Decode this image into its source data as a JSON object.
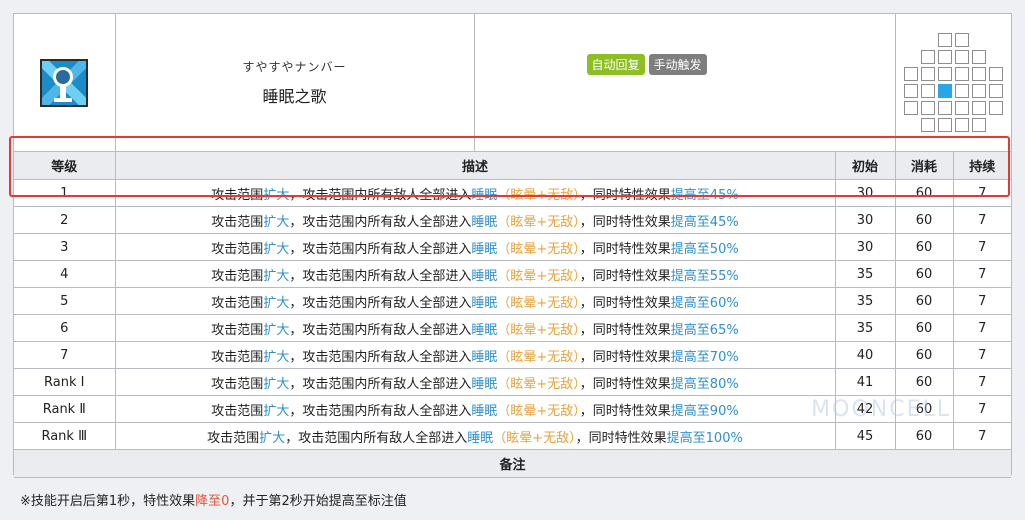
{
  "skill": {
    "subname": "すやすやナンバー",
    "name": "睡眠之歌",
    "icon": "microphone-icon",
    "tags": [
      {
        "label": "自动回复",
        "color": "#8dbf22"
      },
      {
        "label": "手动触发",
        "color": "#7e7e7e"
      }
    ]
  },
  "range_grid": {
    "cells": [
      [
        0,
        2
      ],
      [
        0,
        3
      ],
      [
        1,
        1
      ],
      [
        1,
        2
      ],
      [
        1,
        3
      ],
      [
        1,
        4
      ],
      [
        2,
        0
      ],
      [
        2,
        1
      ],
      [
        2,
        2
      ],
      [
        2,
        3
      ],
      [
        2,
        4
      ],
      [
        2,
        5
      ],
      [
        3,
        0
      ],
      [
        3,
        1
      ],
      [
        3,
        3
      ],
      [
        3,
        4
      ],
      [
        3,
        5
      ],
      [
        4,
        0
      ],
      [
        4,
        1
      ],
      [
        4,
        2
      ],
      [
        4,
        3
      ],
      [
        4,
        4
      ],
      [
        4,
        5
      ],
      [
        5,
        1
      ],
      [
        5,
        2
      ],
      [
        5,
        3
      ],
      [
        5,
        4
      ]
    ],
    "self": [
      3,
      2
    ],
    "self_color": "#27a6e8"
  },
  "table": {
    "headers": {
      "level": "等级",
      "desc": "描述",
      "initial": "初始",
      "cost": "消耗",
      "duration": "持续"
    },
    "desc_parts": {
      "p1": "攻击范围",
      "p2": "扩大",
      "p3": "，攻击范围内所有敌人全部进入",
      "p4": "睡眠",
      "p5": "（眩晕+无敌）",
      "p6": "，同时特性效果",
      "p7": "提高至"
    },
    "rows": [
      {
        "level": "1",
        "value": "45%",
        "initial": "30",
        "cost": "60",
        "duration": "7"
      },
      {
        "level": "2",
        "value": "45%",
        "initial": "30",
        "cost": "60",
        "duration": "7"
      },
      {
        "level": "3",
        "value": "50%",
        "initial": "30",
        "cost": "60",
        "duration": "7"
      },
      {
        "level": "4",
        "value": "55%",
        "initial": "35",
        "cost": "60",
        "duration": "7"
      },
      {
        "level": "5",
        "value": "60%",
        "initial": "35",
        "cost": "60",
        "duration": "7"
      },
      {
        "level": "6",
        "value": "65%",
        "initial": "35",
        "cost": "60",
        "duration": "7"
      },
      {
        "level": "7",
        "value": "70%",
        "initial": "40",
        "cost": "60",
        "duration": "7"
      },
      {
        "level": "Rank Ⅰ",
        "value": "80%",
        "initial": "41",
        "cost": "60",
        "duration": "7"
      },
      {
        "level": "Rank Ⅱ",
        "value": "90%",
        "initial": "42",
        "cost": "60",
        "duration": "7"
      },
      {
        "level": "Rank Ⅲ",
        "value": "100%",
        "initial": "45",
        "cost": "60",
        "duration": "7"
      }
    ],
    "highlighted_rows": [
      0,
      1
    ],
    "highlight_color": "#e53935"
  },
  "notes": {
    "header": "备注",
    "text_before": "※技能开启后第1秒，特性效果",
    "text_red": "降至0",
    "text_after": "，并于第2秒开始提高至标注值"
  },
  "watermark": "MOONCELL",
  "colors": {
    "blue": "#2f8fd0",
    "orange": "#e8a33d",
    "red": "#e2553c"
  }
}
